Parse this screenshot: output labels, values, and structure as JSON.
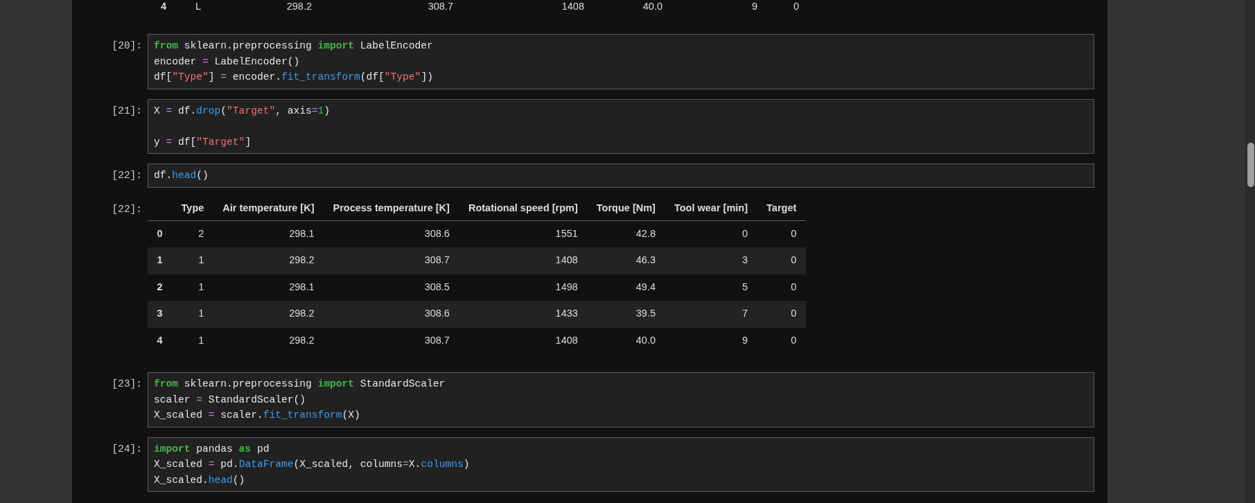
{
  "previous_output": {
    "partial_row": [
      "4",
      "L",
      "298.2",
      "308.7",
      "1408",
      "40.0",
      "9",
      "0"
    ]
  },
  "cells": [
    {
      "prompt": "[20]:",
      "lines": [
        {
          "kind": "code",
          "tokens": [
            {
              "kind": "keyword",
              "text": "from"
            },
            {
              "kind": "plain",
              "text": " sklearn.preprocessing "
            },
            {
              "kind": "keyword",
              "text": "import"
            },
            {
              "kind": "plain",
              "text": " LabelEncoder"
            }
          ]
        },
        {
          "kind": "code",
          "tokens": [
            {
              "kind": "plain",
              "text": "encoder "
            },
            {
              "kind": "operator",
              "text": "="
            },
            {
              "kind": "plain",
              "text": " LabelEncoder()"
            }
          ]
        },
        {
          "kind": "code",
          "tokens": [
            {
              "kind": "plain",
              "text": "df["
            },
            {
              "kind": "string",
              "text": "\"Type\""
            },
            {
              "kind": "plain",
              "text": "] "
            },
            {
              "kind": "operator",
              "text": "="
            },
            {
              "kind": "plain",
              "text": " encoder."
            },
            {
              "kind": "function",
              "text": "fit_transform"
            },
            {
              "kind": "plain",
              "text": "(df["
            },
            {
              "kind": "string",
              "text": "\"Type\""
            },
            {
              "kind": "plain",
              "text": "])"
            }
          ]
        }
      ]
    },
    {
      "prompt": "[21]:",
      "lines": [
        {
          "kind": "code",
          "tokens": [
            {
              "kind": "plain",
              "text": "X "
            },
            {
              "kind": "operator",
              "text": "="
            },
            {
              "kind": "plain",
              "text": " df."
            },
            {
              "kind": "function",
              "text": "drop"
            },
            {
              "kind": "plain",
              "text": "("
            },
            {
              "kind": "string",
              "text": "\"Target\""
            },
            {
              "kind": "plain",
              "text": ", axis"
            },
            {
              "kind": "operator",
              "text": "="
            },
            {
              "kind": "number",
              "text": "1"
            },
            {
              "kind": "plain",
              "text": ")"
            }
          ]
        },
        {
          "kind": "blank"
        },
        {
          "kind": "code",
          "tokens": [
            {
              "kind": "plain",
              "text": "y "
            },
            {
              "kind": "operator",
              "text": "="
            },
            {
              "kind": "plain",
              "text": " df["
            },
            {
              "kind": "string",
              "text": "\"Target\""
            },
            {
              "kind": "plain",
              "text": "]"
            }
          ]
        }
      ]
    },
    {
      "prompt": "[22]:",
      "lines": [
        {
          "kind": "code",
          "tokens": [
            {
              "kind": "plain",
              "text": "df."
            },
            {
              "kind": "function",
              "text": "head"
            },
            {
              "kind": "plain",
              "text": "()"
            }
          ]
        }
      ],
      "output": {
        "prompt": "[22]:",
        "table": {
          "columns": [
            "",
            "Type",
            "Air temperature [K]",
            "Process temperature [K]",
            "Rotational speed [rpm]",
            "Torque [Nm]",
            "Tool wear [min]",
            "Target"
          ],
          "rows": [
            [
              "0",
              "2",
              "298.1",
              "308.6",
              "1551",
              "42.8",
              "0",
              "0"
            ],
            [
              "1",
              "1",
              "298.2",
              "308.7",
              "1408",
              "46.3",
              "3",
              "0"
            ],
            [
              "2",
              "1",
              "298.1",
              "308.5",
              "1498",
              "49.4",
              "5",
              "0"
            ],
            [
              "3",
              "1",
              "298.2",
              "308.6",
              "1433",
              "39.5",
              "7",
              "0"
            ],
            [
              "4",
              "1",
              "298.2",
              "308.7",
              "1408",
              "40.0",
              "9",
              "0"
            ]
          ]
        }
      }
    },
    {
      "prompt": "[23]:",
      "lines": [
        {
          "kind": "code",
          "tokens": [
            {
              "kind": "keyword",
              "text": "from"
            },
            {
              "kind": "plain",
              "text": " sklearn.preprocessing "
            },
            {
              "kind": "keyword",
              "text": "import"
            },
            {
              "kind": "plain",
              "text": " StandardScaler"
            }
          ]
        },
        {
          "kind": "code",
          "tokens": [
            {
              "kind": "plain",
              "text": "scaler "
            },
            {
              "kind": "operator",
              "text": "="
            },
            {
              "kind": "plain",
              "text": " StandardScaler()"
            }
          ]
        },
        {
          "kind": "code",
          "tokens": [
            {
              "kind": "plain",
              "text": "X_scaled "
            },
            {
              "kind": "operator",
              "text": "="
            },
            {
              "kind": "plain",
              "text": " scaler."
            },
            {
              "kind": "function",
              "text": "fit_transform"
            },
            {
              "kind": "plain",
              "text": "(X)"
            }
          ]
        }
      ]
    },
    {
      "prompt": "[24]:",
      "lines": [
        {
          "kind": "code",
          "tokens": [
            {
              "kind": "keyword",
              "text": "import"
            },
            {
              "kind": "plain",
              "text": " pandas "
            },
            {
              "kind": "keyword",
              "text": "as"
            },
            {
              "kind": "plain",
              "text": " pd"
            }
          ]
        },
        {
          "kind": "code",
          "tokens": [
            {
              "kind": "plain",
              "text": "X_scaled "
            },
            {
              "kind": "operator",
              "text": "="
            },
            {
              "kind": "plain",
              "text": " pd."
            },
            {
              "kind": "function",
              "text": "DataFrame"
            },
            {
              "kind": "plain",
              "text": "(X_scaled, columns"
            },
            {
              "kind": "operator",
              "text": "="
            },
            {
              "kind": "plain",
              "text": "X."
            },
            {
              "kind": "function",
              "text": "columns"
            },
            {
              "kind": "plain",
              "text": ")"
            }
          ]
        },
        {
          "kind": "code",
          "tokens": [
            {
              "kind": "plain",
              "text": "X_scaled."
            },
            {
              "kind": "function",
              "text": "head"
            },
            {
              "kind": "plain",
              "text": "()"
            }
          ]
        }
      ]
    }
  ]
}
